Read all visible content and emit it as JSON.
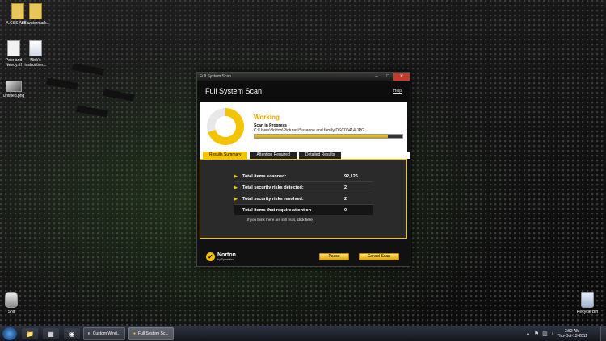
{
  "desktop": {
    "icons": [
      {
        "label": "A.CSS Add...",
        "icon": "folder-icon"
      },
      {
        "label": "SF watermark...",
        "icon": "folder-icon"
      },
      {
        "label": "Poor and Needy.rtf",
        "icon": "document-icon"
      },
      {
        "label": "Nick's instruction...",
        "icon": "document-icon"
      },
      {
        "label": "Untitled.png",
        "icon": "image-icon"
      },
      {
        "label": "Shit",
        "icon": "robot-icon"
      },
      {
        "label": "Recycle Bin",
        "icon": "recycle-bin-icon"
      }
    ]
  },
  "window": {
    "titlebar": "Full System Scan",
    "header_title": "Full System Scan",
    "help_link": "Help",
    "status_title": "Working",
    "status_subtitle": "Scan in Progress",
    "current_path": "C:\\Users\\Britton\\Pictures\\Susanne and family\\DSC00414.JPG",
    "progress_fraction": 0.9,
    "tabs": [
      "Results Summary",
      "Attention Required",
      "Detailed Results"
    ],
    "active_tab": 0,
    "summary": [
      {
        "label": "Total items scanned:",
        "value": "92,126"
      },
      {
        "label": "Total security risks detected:",
        "value": "2"
      },
      {
        "label": "Total security risks resolved:",
        "value": "2"
      },
      {
        "label": "Total items that require attention",
        "value": "0"
      }
    ],
    "hint_text": "If you think there are still risks,",
    "hint_link": "click here",
    "brand_name": "Norton",
    "brand_sub": "by Symantec",
    "pause_button": "Pause",
    "cancel_button": "Cancel Scan"
  },
  "taskbar": {
    "tasks": [
      "Custom Wind...",
      "Full System Sc..."
    ],
    "active_task": 1,
    "time": "3:52 AM",
    "date": "Thu-Oct-13-2011"
  },
  "colors": {
    "accent": "#f5c400",
    "window_bg": "#111111",
    "panel_bg": "#2a2a2a"
  }
}
